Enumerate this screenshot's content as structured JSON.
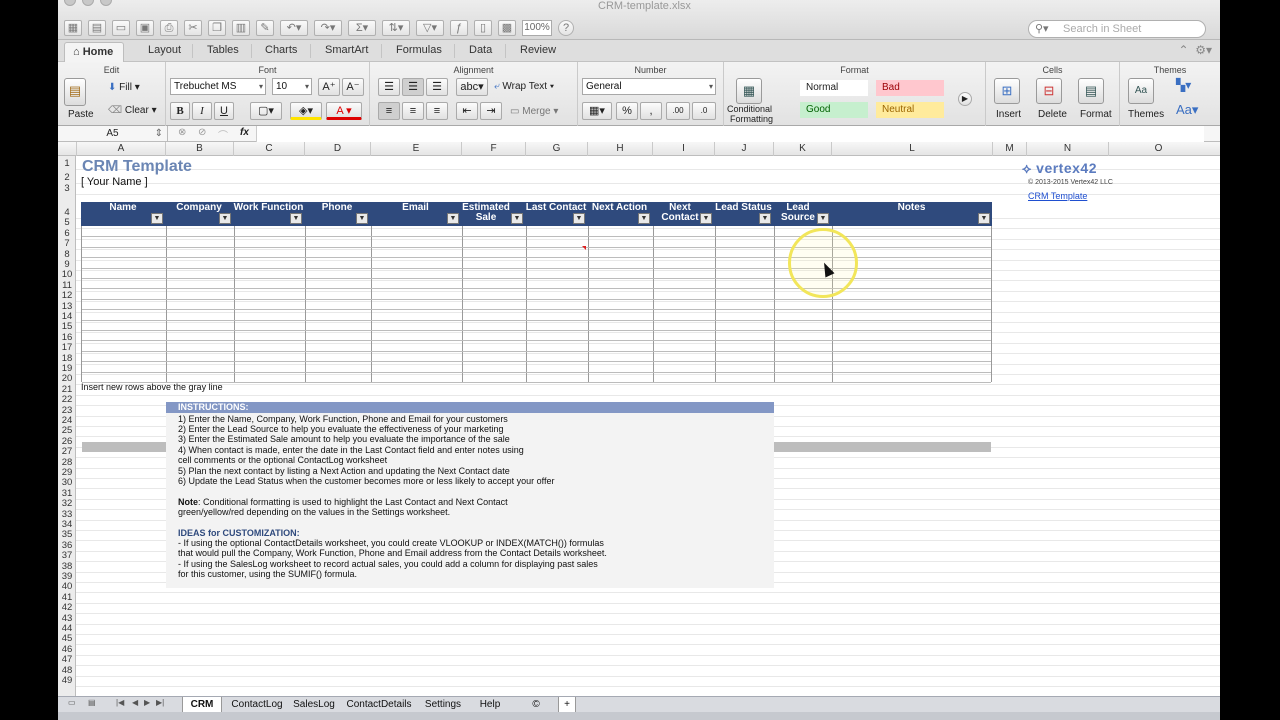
{
  "window": {
    "title": "CRM-template.xlsx",
    "zoom": "100%",
    "search_placeholder": "Search in Sheet"
  },
  "ribbon_tabs": [
    "Home",
    "Layout",
    "Tables",
    "Charts",
    "SmartArt",
    "Formulas",
    "Data",
    "Review"
  ],
  "groups": {
    "edit": "Edit",
    "font": "Font",
    "alignment": "Alignment",
    "number": "Number",
    "format": "Format",
    "cells": "Cells",
    "themes": "Themes"
  },
  "edit": {
    "paste": "Paste",
    "fill": "Fill",
    "clear": "Clear"
  },
  "font": {
    "name": "Trebuchet MS",
    "size": "10",
    "bold": "B",
    "italic": "I",
    "underline": "U",
    "grow": "A",
    "shrink": "A",
    "color_letter": "A"
  },
  "alignment": {
    "abc": "abc",
    "wrap": "Wrap Text",
    "merge": "Merge"
  },
  "number": {
    "format": "General",
    "percent": "%",
    "inc": ".00",
    "dec": ".0"
  },
  "format": {
    "conditional": "Conditional",
    "conditional2": "Formatting",
    "normal": "Normal",
    "bad": "Bad",
    "good": "Good",
    "neutral": "Neutral"
  },
  "cells": {
    "insert": "Insert",
    "delete": "Delete",
    "format": "Format"
  },
  "themes": {
    "themes": "Themes",
    "aa": "Aa",
    "aa_small": "Aa"
  },
  "formula_bar": {
    "cell_ref": "A5",
    "fx": "fx"
  },
  "columns": [
    "A",
    "B",
    "C",
    "D",
    "E",
    "F",
    "G",
    "H",
    "I",
    "J",
    "K",
    "L",
    "M",
    "N",
    "O"
  ],
  "rows": [
    "1",
    "2",
    "3",
    "4",
    "5",
    "6",
    "7",
    "8",
    "9",
    "10",
    "11",
    "12",
    "13",
    "14",
    "15",
    "16",
    "17",
    "18",
    "19",
    "20",
    "21",
    "22",
    "23",
    "24",
    "25",
    "26",
    "27",
    "28",
    "29",
    "30",
    "31",
    "32",
    "33",
    "34",
    "35",
    "36",
    "37",
    "38",
    "39",
    "40",
    "41",
    "42",
    "43",
    "44",
    "45",
    "46",
    "47",
    "48",
    "49"
  ],
  "sheet": {
    "title": "CRM Template",
    "subtitle": "[ Your Name ]",
    "headers": [
      "Name",
      "Company",
      "Work Function",
      "Phone",
      "Email",
      "Estimated Sale",
      "Last Contact",
      "Next Action",
      "Next Contact",
      "Lead Status",
      "Lead Source",
      "Notes"
    ],
    "insert_note": "Insert new rows above the gray line",
    "logo": "vertex42",
    "copyright": "© 2013-2015 Vertex42 LLC",
    "link": "CRM Template"
  },
  "instructions": {
    "heading": "INSTRUCTIONS:",
    "lines": [
      "1) Enter the Name, Company, Work Function, Phone and Email for your customers",
      "2) Enter the Lead Source to help you evaluate the effectiveness of your marketing",
      "3) Enter the Estimated Sale amount to help you evaluate the importance of the sale",
      "4) When contact is made, enter the date in the Last Contact field and enter notes using",
      "cell comments or the optional ContactLog worksheet",
      "5) Plan the next contact by listing a Next Action and updating the Next Contact date",
      "6) Update the Lead Status when the customer becomes more or less likely to accept your offer"
    ],
    "note_label": "Note",
    "note_1": ": Conditional formatting is used to highlight the Last Contact and Next Contact",
    "note_2": "green/yellow/red depending on the values in the Settings worksheet.",
    "ideas_heading": "IDEAS for CUSTOMIZATION:",
    "ideas": [
      "- If using the optional ContactDetails worksheet, you could create VLOOKUP or INDEX(MATCH()) formulas",
      "that would pull the Company, Work Function, Phone and Email address from the Contact Details worksheet.",
      "- If using the SalesLog worksheet to record actual sales, you could add a column for displaying past sales",
      "for this customer, using the SUMIF() formula."
    ]
  },
  "sheet_tabs": [
    "CRM",
    "ContactLog",
    "SalesLog",
    "ContactDetails",
    "Settings",
    "Help",
    "©",
    "+"
  ],
  "colors": {
    "header_bg": "#2f4a7d",
    "title": "#6b86b4",
    "instr_bar": "#8397c5",
    "bad_bg": "#ffc7ce",
    "good_bg": "#c6efce",
    "neutral_bg": "#ffeb9c"
  }
}
